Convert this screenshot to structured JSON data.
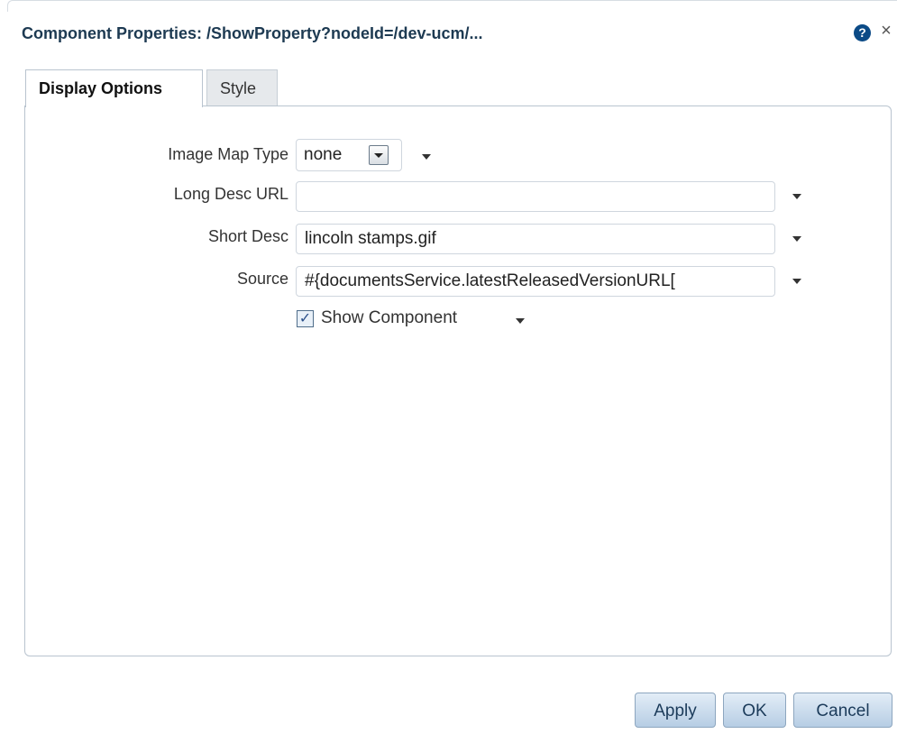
{
  "dialog": {
    "title": "Component Properties: /ShowProperty?nodeId=/dev-ucm/...",
    "help_icon": "?",
    "close_icon": "×"
  },
  "tabs": [
    {
      "label": "Display Options",
      "active": true
    },
    {
      "label": "Style",
      "active": false
    }
  ],
  "form": {
    "image_map_type": {
      "label": "Image Map Type",
      "value": "none"
    },
    "long_desc_url": {
      "label": "Long Desc URL",
      "value": ""
    },
    "short_desc": {
      "label": "Short Desc",
      "value": "lincoln stamps.gif"
    },
    "source": {
      "label": "Source",
      "value": "#{documentsService.latestReleasedVersionURL["
    },
    "show_component": {
      "label": "Show Component",
      "checked": true,
      "check_glyph": "✓"
    }
  },
  "buttons": {
    "apply": "Apply",
    "ok": "OK",
    "cancel": "Cancel"
  },
  "colors": {
    "title": "#1d3a52",
    "help_icon": "#0b4a86",
    "button_border": "#8da6bf"
  }
}
